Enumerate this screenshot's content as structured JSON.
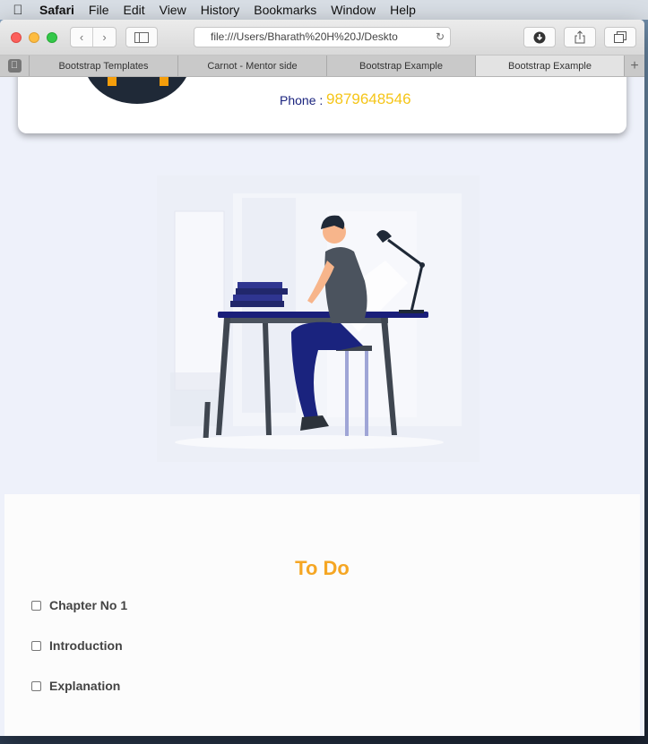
{
  "menubar": {
    "apple": "",
    "items": [
      "Safari",
      "File",
      "Edit",
      "View",
      "History",
      "Bookmarks",
      "Window",
      "Help"
    ]
  },
  "toolbar": {
    "back": "‹",
    "forward": "›",
    "address": "file:///Users/Bharath%20H%20J/Deskto"
  },
  "tabs": {
    "items": [
      {
        "label": "Bootstrap Templates"
      },
      {
        "label": "Carnot - Mentor side"
      },
      {
        "label": "Bootstrap Example"
      },
      {
        "label": "Bootstrap Example"
      }
    ],
    "new_tab": "+"
  },
  "profile": {
    "phone_label": "Phone :",
    "phone_number": "9879648546"
  },
  "todo": {
    "title": "To Do",
    "items": [
      {
        "label": "Chapter No 1",
        "checked": false
      },
      {
        "label": "Introduction",
        "checked": false
      },
      {
        "label": "Explanation",
        "checked": false
      }
    ]
  },
  "colors": {
    "accent": "#f5a623",
    "phone": "#f5c518",
    "page_bg": "#eef1fa",
    "desk_blue": "#1a1f7a"
  }
}
